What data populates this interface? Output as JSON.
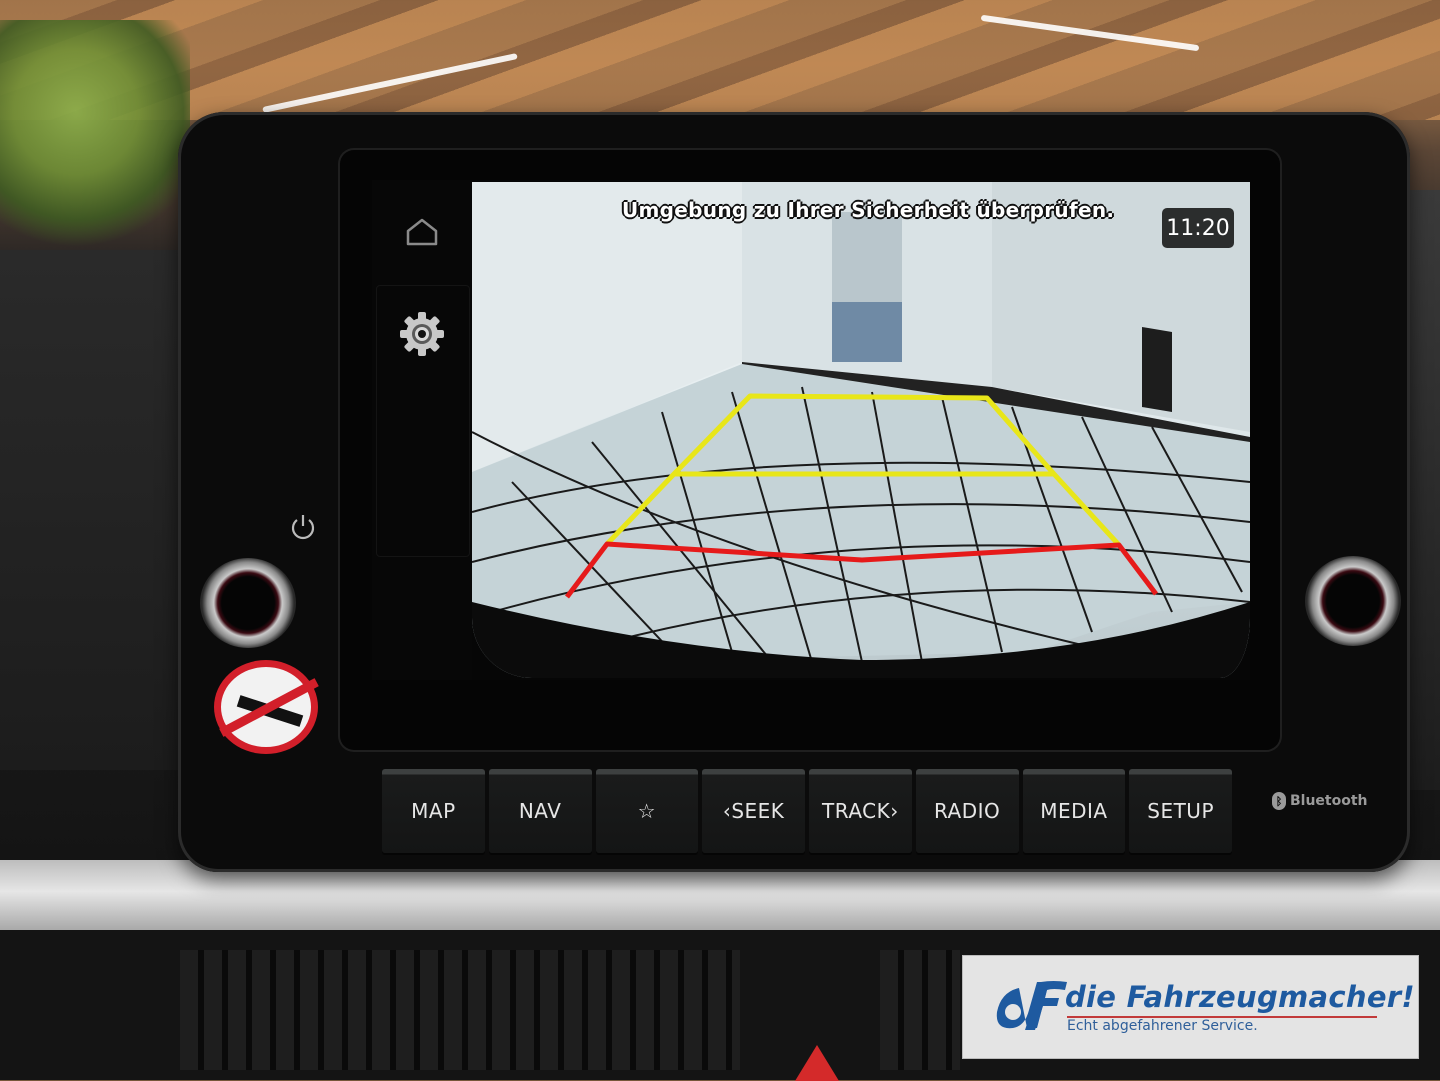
{
  "screen": {
    "warning_message": "Umgebung zu Ihrer Sicherheit überprüfen.",
    "clock": "11:20",
    "sidebar": {
      "items": [
        {
          "id": "home",
          "icon": "home-icon"
        },
        {
          "id": "settings",
          "icon": "gear-icon"
        }
      ]
    },
    "guidelines": {
      "colors": {
        "far": "#e8e619",
        "near": "#e61a1a"
      }
    }
  },
  "hardware": {
    "buttons": [
      {
        "label": "MAP"
      },
      {
        "label": "NAV"
      },
      {
        "label": "☆",
        "icon": "star-icon"
      },
      {
        "label": "‹SEEK"
      },
      {
        "label": "TRACK›"
      },
      {
        "label": "RADIO"
      },
      {
        "label": "MEDIA"
      },
      {
        "label": "SETUP"
      }
    ],
    "bluetooth_label": "Bluetooth"
  },
  "watermark": {
    "brand": "die Fahrzeugmacher!",
    "tagline": "Echt abgefahrener Service."
  }
}
